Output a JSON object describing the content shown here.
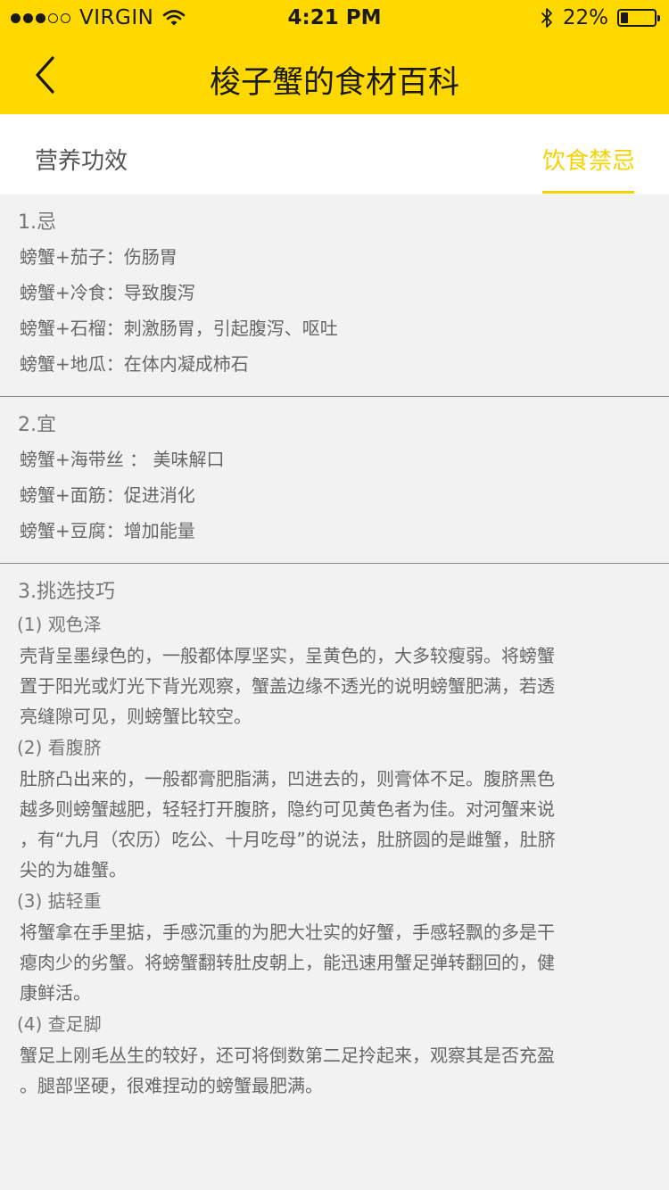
{
  "status_bar": {
    "carrier": "VIRGIN",
    "time": "4:21 PM",
    "battery_text": "22%",
    "battery_level": 0.22
  },
  "nav": {
    "title": "梭子蟹的食材百科"
  },
  "tabs": [
    {
      "label": "营养功效",
      "active": false
    },
    {
      "label": "饮食禁忌",
      "active": true
    }
  ],
  "sections": [
    {
      "title": "1.忌",
      "items": [
        "螃蟹+茄子：伤肠胃",
        "螃蟹+冷食：导致腹泻",
        "螃蟹+石榴：刺激肠胃，引起腹泻、呕吐",
        "螃蟹+地瓜：在体内凝成柿石"
      ]
    },
    {
      "title": "2.宜",
      "items": [
        "螃蟹+海带丝 ： 美味解口",
        "螃蟹+面筋：促进消化",
        "螃蟹+豆腐：增加能量"
      ]
    },
    {
      "title": "3.挑选技巧",
      "subsections": [
        {
          "title": "(1) 观色泽",
          "lines": [
            "壳背呈墨绿色的，一般都体厚坚实，呈黄色的，大多较瘦弱。将螃蟹",
            "置于阳光或灯光下背光观察，蟹盖边缘不透光的说明螃蟹肥满，若透",
            "亮缝隙可见，则螃蟹比较空。"
          ]
        },
        {
          "title": "(2) 看腹脐",
          "lines": [
            "肚脐凸出来的，一般都膏肥脂满，凹进去的，则膏体不足。腹脐黑色",
            "越多则螃蟹越肥，轻轻打开腹脐，隐约可见黄色者为佳。对河蟹来说",
            "，有“九月（农历）吃公、十月吃母”的说法，肚脐圆的是雌蟹，肚脐",
            "尖的为雄蟹。"
          ]
        },
        {
          "title": "(3) 掂轻重",
          "lines": [
            "将蟹拿在手里掂，手感沉重的为肥大壮实的好蟹，手感轻飘的多是干",
            "瘪肉少的劣蟹。将螃蟹翻转肚皮朝上，能迅速用蟹足弹转翻回的，健",
            "康鲜活。"
          ]
        },
        {
          "title": "(4) 查足脚",
          "lines": [
            "蟹足上刚毛丛生的较好，还可将倒数第二足拎起来，观察其是否充盈",
            "。腿部坚硬，很难捏动的螃蟹最肥满。"
          ]
        }
      ]
    }
  ]
}
